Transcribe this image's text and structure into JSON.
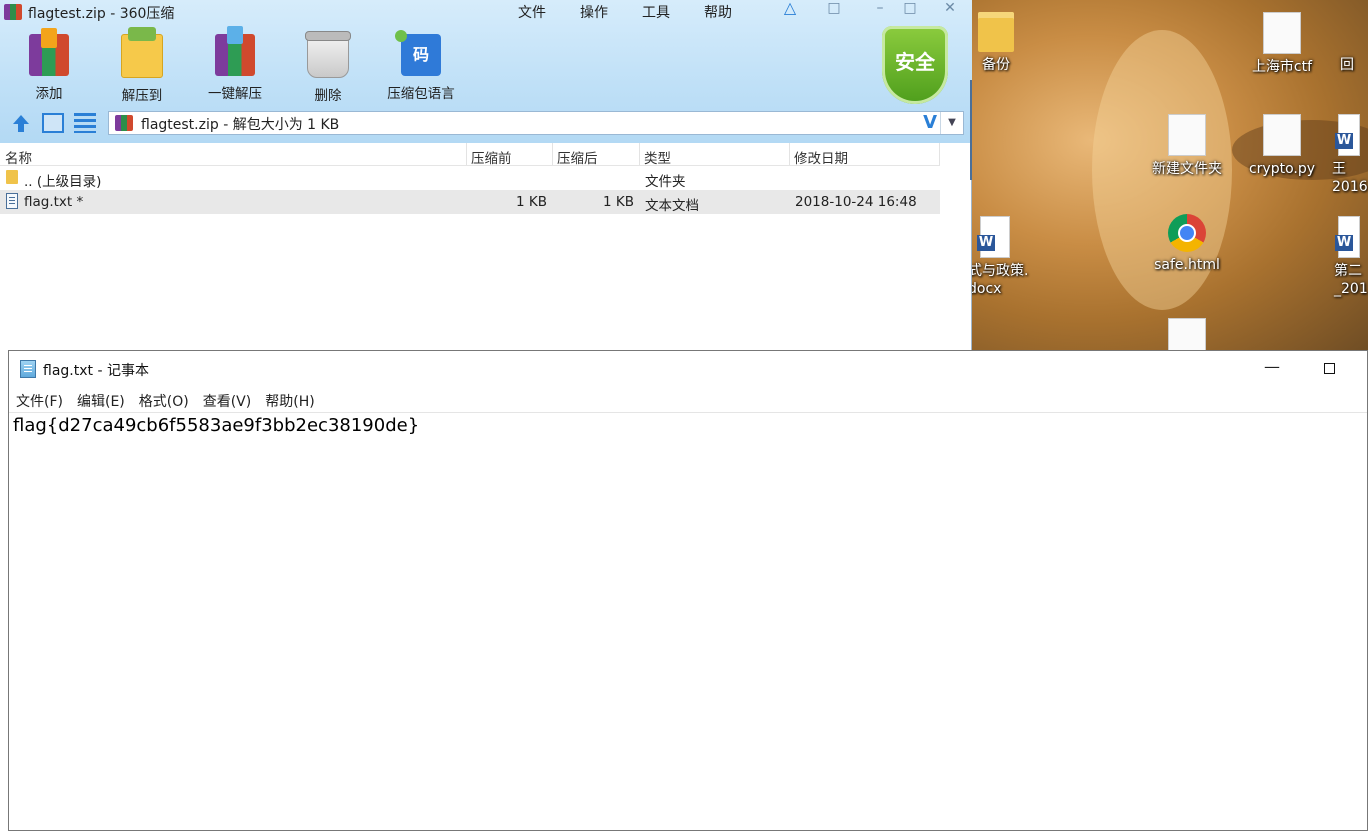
{
  "zip_window": {
    "title": "flagtest.zip - 360压缩",
    "menu": [
      "文件",
      "操作",
      "工具",
      "帮助"
    ],
    "toolbar": {
      "add": "添加",
      "extract_to": "解压到",
      "one_click_extract": "一键解压",
      "delete": "删除",
      "archive_language": "压缩包语言"
    },
    "shield_label": "安全",
    "address": "flagtest.zip - 解包大小为 1 KB",
    "columns": {
      "name": "名称",
      "compressed_before": "压缩前",
      "compressed_after": "压缩后",
      "type": "类型",
      "modified": "修改日期"
    },
    "rows": [
      {
        "name": ".. (上级目录)",
        "before": "",
        "after": "",
        "type": "文件夹",
        "modified": ""
      },
      {
        "name": "flag.txt *",
        "before": "1 KB",
        "after": "1 KB",
        "type": "文本文档",
        "modified": "2018-10-24 16:48"
      }
    ]
  },
  "desktop": {
    "icons": [
      "备份",
      "上海市ctf",
      "回",
      "新建文件夹",
      "crypto.py",
      "王",
      "2016",
      "式与政策.",
      "docx",
      "safe.html",
      "第二",
      "_201"
    ]
  },
  "notepad": {
    "title": "flag.txt - 记事本",
    "menu": {
      "file": "文件(F)",
      "edit": "编辑(E)",
      "format": "格式(O)",
      "view": "查看(V)",
      "help": "帮助(H)"
    },
    "content": "flag{d27ca49cb6f5583ae9f3bb2ec38190de}"
  }
}
